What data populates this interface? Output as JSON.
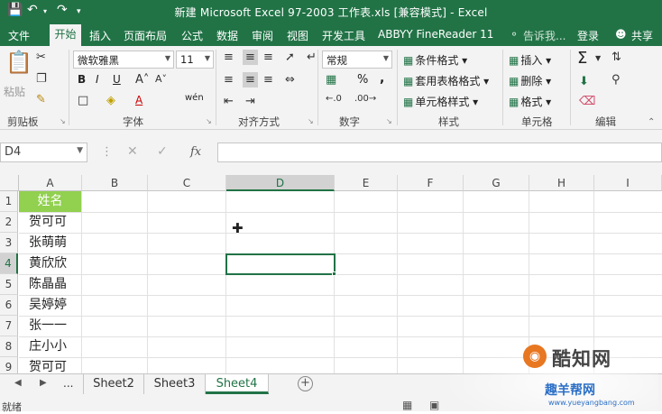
{
  "window": {
    "title": "新建 Microsoft Excel 97-2003 工作表.xls  [兼容模式] - Excel"
  },
  "ribbon_tabs": [
    "文件",
    "开始",
    "插入",
    "页面布局",
    "公式",
    "数据",
    "审阅",
    "视图",
    "开发工具",
    "ABBYY FineReader 11"
  ],
  "tell_me": "告诉我...",
  "account": {
    "login": "登录",
    "share": "共享"
  },
  "clipboard": {
    "paste": "粘贴",
    "group": "剪贴板"
  },
  "font": {
    "name": "微软雅黑",
    "size": "11",
    "bold": "B",
    "italic": "I",
    "underline": "U",
    "font_color": "A",
    "phonetic": "wén",
    "group": "字体"
  },
  "alignment": {
    "group": "对齐方式"
  },
  "number": {
    "format": "常规",
    "percent": "%",
    "comma": ",",
    "group": "数字"
  },
  "styles": {
    "conditional": "条件格式",
    "table": "套用表格格式",
    "cell_styles": "单元格样式",
    "group": "样式"
  },
  "cells": {
    "insert": "插入",
    "delete": "删除",
    "format": "格式",
    "group": "单元格"
  },
  "editing": {
    "group": "编辑",
    "sum": "Σ"
  },
  "formula_bar": {
    "name_box": "D4",
    "fx": "fx",
    "cancel": "✕",
    "enter": "✓",
    "value": ""
  },
  "grid": {
    "columns": [
      "A",
      "B",
      "C",
      "D",
      "E",
      "F",
      "G",
      "H",
      "I"
    ],
    "rows": [
      "1",
      "2",
      "3",
      "4",
      "5",
      "6",
      "7",
      "8",
      "9"
    ],
    "cells_a": [
      "姓名",
      "贺可可",
      "张萌萌",
      "黄欣欣",
      "陈晶晶",
      "吴婷婷",
      "张一一",
      "庄小小",
      "贺可可"
    ],
    "active_cell": "D4"
  },
  "sheets": {
    "nav_prev": "◀",
    "nav_next": "▶",
    "more": "...",
    "tabs": [
      "Sheet2",
      "Sheet3",
      "Sheet4"
    ],
    "active": "Sheet4",
    "add": "+"
  },
  "status": {
    "ready": "就绪"
  },
  "watermark": {
    "brand": "酷知网",
    "site_name": "趣羊帮网",
    "url": "www.yueyangbang.com"
  },
  "colors": {
    "excel_green": "#217346",
    "header_fill": "#92D050",
    "ribbon_bg": "#f3f3f3"
  }
}
